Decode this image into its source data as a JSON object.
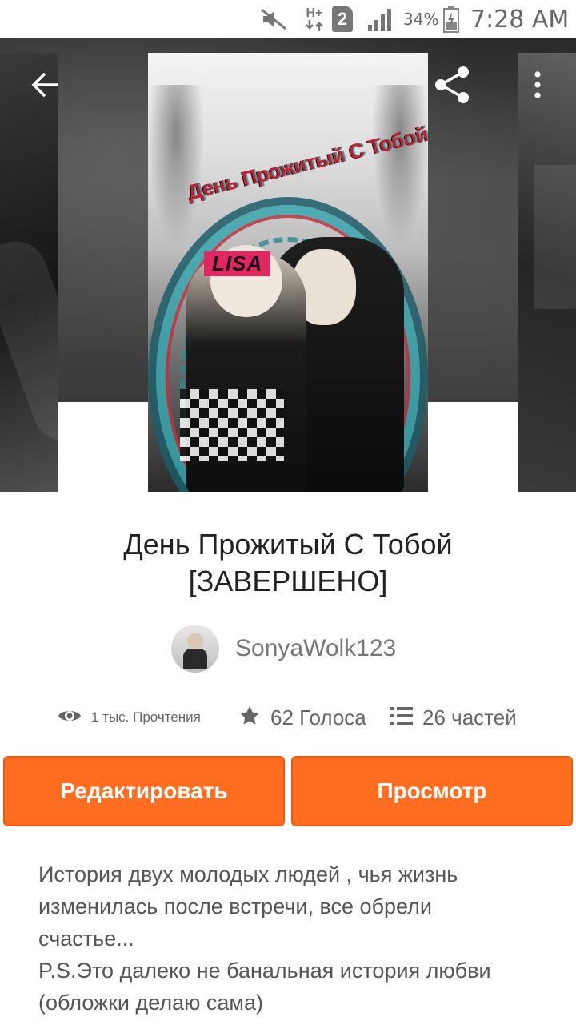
{
  "status_bar": {
    "signal_type": "H+",
    "sim_slot": "2",
    "battery": "34%",
    "time": "7:28 AM",
    "icons": [
      "mute-icon",
      "data-arrows-icon",
      "sim-icon",
      "signal-icon",
      "battery-icon"
    ]
  },
  "hero": {
    "cover_title": "День Прожитый С Тобой",
    "cover_tag": "LISA",
    "back_icon": "arrow-left-icon",
    "share_icon": "share-icon",
    "more_icon": "more-vert-icon"
  },
  "story": {
    "title_line1": "День Прожитый С Тобой",
    "title_line2": "[ЗАВЕРШЕНО]",
    "author": "SonyaWolk123"
  },
  "stats": {
    "reads": "1 тыс. Прочтения",
    "votes": "62 Голоса",
    "parts": "26 частей"
  },
  "actions": {
    "edit_label": "Редактировать",
    "view_label": "Просмотр"
  },
  "description": [
    "История двух молодых людей , чья жизнь",
    "изменилась после встречи, все обрели",
    "счастье...",
    "P.S.Это далеко не банальная история любви",
    "(обложки делаю сама)"
  ],
  "colors": {
    "accent": "#ff6d20",
    "text_primary": "#222222",
    "text_secondary": "#666666"
  }
}
